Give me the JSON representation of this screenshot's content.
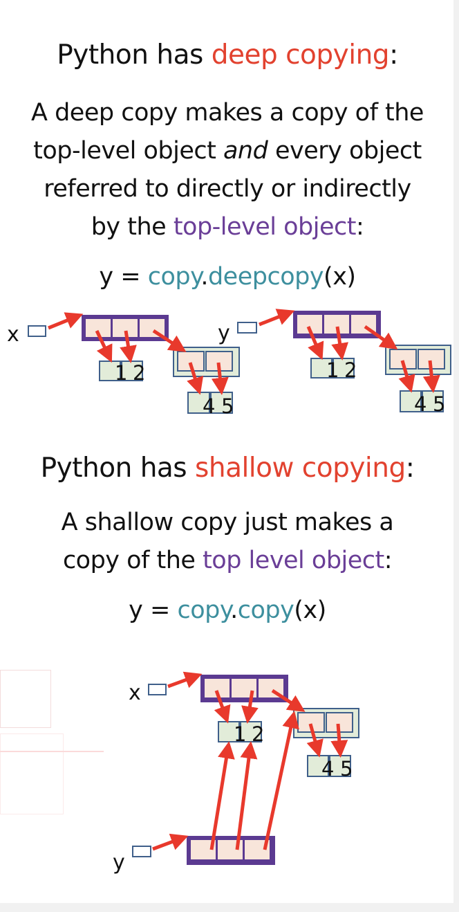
{
  "deep": {
    "heading": {
      "prefix": "Python has ",
      "highlight": "deep copying",
      "suffix": ":"
    },
    "line1": "A deep copy makes a copy of the",
    "line2": {
      "prefix": "top-level object ",
      "emph": "and",
      "suffix": " every object"
    },
    "line3": "referred to directly or indirectly",
    "line4": {
      "prefix": "by the ",
      "highlight": "top-level object",
      "suffix": ":"
    },
    "code": {
      "lhs": "y = ",
      "module": "copy",
      "dot": ".",
      "func": "deepcopy",
      "args": "(x)"
    }
  },
  "shallow": {
    "heading": {
      "prefix": "Python has ",
      "highlight": "shallow copying",
      "suffix": ":"
    },
    "line1": "A shallow copy just makes a",
    "line2": {
      "prefix": "copy of the ",
      "highlight": "top level object",
      "suffix": ":"
    },
    "code": {
      "lhs": "y = ",
      "module": "copy",
      "dot": ".",
      "func": "copy",
      "args": "(x)"
    }
  },
  "diagram": {
    "var_x": "x",
    "var_y": "y",
    "inner_list_a": [
      "1",
      "2"
    ],
    "inner_list_b": [
      "4",
      "5"
    ]
  },
  "colors": {
    "accent_red": "#e2422f",
    "accent_purple": "#6a3e97",
    "accent_teal": "#3d8f9e",
    "list_border_purple": "#5b3a91",
    "cell_fill": "#f8e5da",
    "int_fill": "#e2ecd9",
    "int_border": "#3f5f8a",
    "arrow_red": "#e8392c"
  }
}
